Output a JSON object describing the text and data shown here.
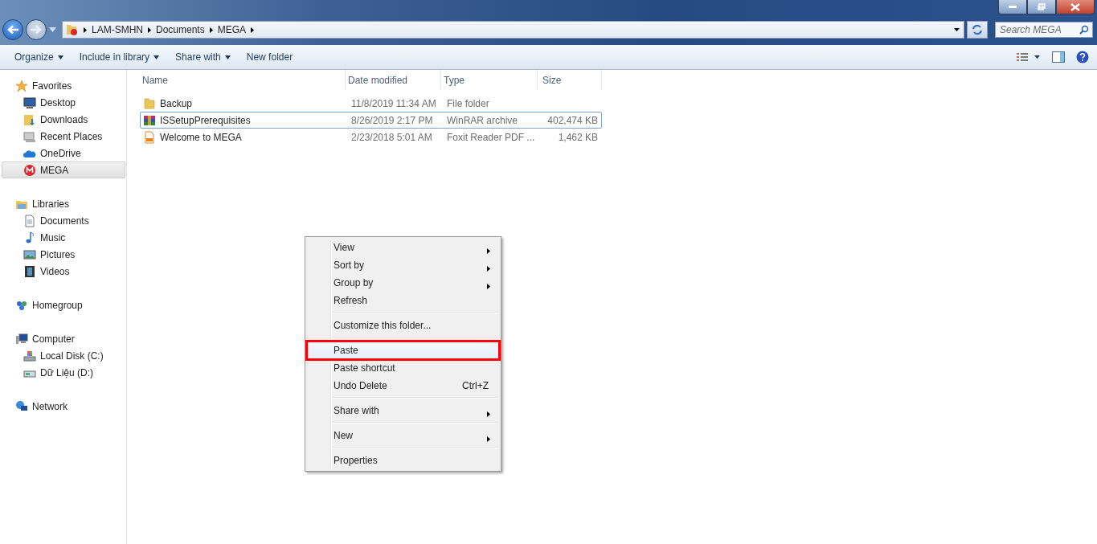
{
  "address_bar": {
    "crumbs": [
      "LAM-SMHN",
      "Documents",
      "MEGA"
    ]
  },
  "search": {
    "placeholder": "Search MEGA"
  },
  "toolbar": {
    "buttons": [
      {
        "label": "Organize",
        "dropdown": true
      },
      {
        "label": "Include in library",
        "dropdown": true
      },
      {
        "label": "Share with",
        "dropdown": true
      },
      {
        "label": "New folder",
        "dropdown": false
      }
    ]
  },
  "sidebar": {
    "groups": [
      {
        "label": "Favorites",
        "kind": "star",
        "children": [
          {
            "label": "Desktop",
            "kind": "desktop",
            "selected": false
          },
          {
            "label": "Downloads",
            "kind": "downloads",
            "selected": false
          },
          {
            "label": "Recent Places",
            "kind": "recent",
            "selected": false
          },
          {
            "label": "OneDrive",
            "kind": "cloud",
            "selected": false
          },
          {
            "label": "MEGA",
            "kind": "mega",
            "selected": true
          }
        ]
      },
      {
        "label": "Libraries",
        "kind": "library",
        "children": [
          {
            "label": "Documents",
            "kind": "document",
            "selected": false
          },
          {
            "label": "Music",
            "kind": "music",
            "selected": false
          },
          {
            "label": "Pictures",
            "kind": "pictures",
            "selected": false
          },
          {
            "label": "Videos",
            "kind": "videos",
            "selected": false
          }
        ]
      },
      {
        "label": "Homegroup",
        "kind": "homegroup"
      },
      {
        "label": "Computer",
        "kind": "computer",
        "children": [
          {
            "label": "Local Disk (C:)",
            "kind": "disk",
            "selected": false
          },
          {
            "label": "Dữ Liệu (D:)",
            "kind": "drive",
            "selected": false
          }
        ]
      },
      {
        "label": "Network",
        "kind": "network"
      }
    ]
  },
  "table": {
    "columns": [
      "Name",
      "Date modified",
      "Type",
      "Size"
    ],
    "rows": [
      {
        "name": "Backup",
        "kind": "folder",
        "date": "11/8/2019 11:34 AM",
        "type": "File folder",
        "selected": false
      },
      {
        "name": "ISSetupPrerequisites",
        "kind": "archive",
        "date": "8/26/2019 2:17 PM",
        "type": "WinRAR archive",
        "size": "402,474 KB",
        "selected": true
      },
      {
        "name": "Welcome to MEGA",
        "kind": "pdf",
        "date": "2/23/2018 5:01 AM",
        "type": "Foxit Reader PDF ...",
        "size": "1,462 KB",
        "selected": false
      }
    ]
  },
  "context_menu": {
    "items": [
      {
        "kind": "item",
        "label": "View",
        "submenu": true,
        "selected": false
      },
      {
        "kind": "item",
        "label": "Sort by",
        "submenu": true,
        "selected": false
      },
      {
        "kind": "item",
        "label": "Group by",
        "submenu": true,
        "selected": false
      },
      {
        "kind": "item",
        "label": "Refresh",
        "submenu": false,
        "selected": false
      },
      {
        "kind": "separator"
      },
      {
        "kind": "item",
        "label": "Customize this folder...",
        "submenu": false,
        "selected": false
      },
      {
        "kind": "separator"
      },
      {
        "kind": "item",
        "label": "Paste",
        "submenu": false,
        "selected": true
      },
      {
        "kind": "item",
        "label": "Paste shortcut",
        "submenu": false,
        "selected": false
      },
      {
        "kind": "item",
        "label": "Undo Delete",
        "shortcut": "Ctrl+Z",
        "submenu": false,
        "selected": false
      },
      {
        "kind": "separator"
      },
      {
        "kind": "item",
        "label": "Share with",
        "submenu": true,
        "selected": false
      },
      {
        "kind": "separator"
      },
      {
        "kind": "item",
        "label": "New",
        "submenu": true,
        "selected": false
      },
      {
        "kind": "separator"
      },
      {
        "kind": "item",
        "label": "Properties",
        "submenu": false,
        "selected": false
      }
    ]
  }
}
